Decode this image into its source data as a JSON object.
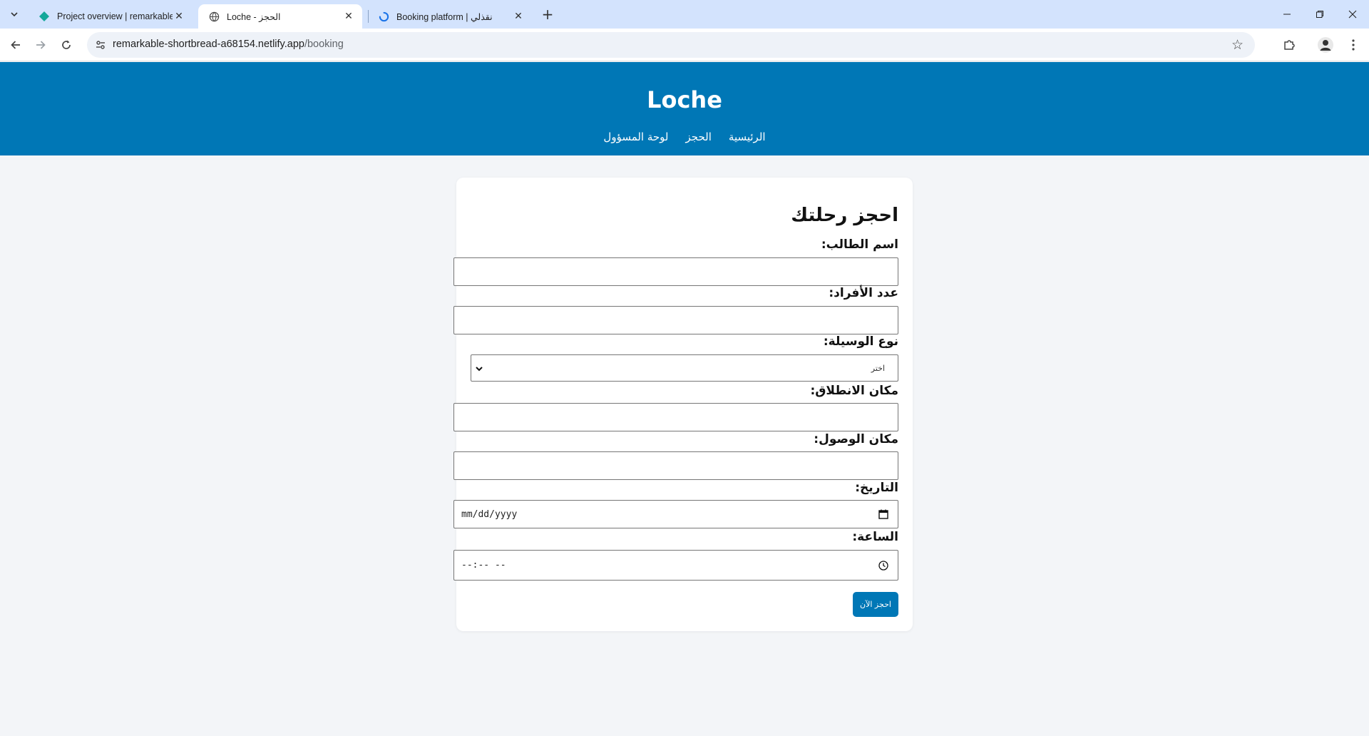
{
  "browser": {
    "tabs": [
      {
        "title": "Project overview | remarkable-s",
        "favicon": "netlify-diamond-icon",
        "active": false
      },
      {
        "title": "Loche - الحجز",
        "favicon": "globe-icon",
        "active": true
      },
      {
        "title": "Booking platform | نقذلي",
        "favicon": "loading-spinner-icon",
        "active": false
      }
    ],
    "url_host": "remarkable-shortbread-a68154.netlify.app",
    "url_path": "/booking",
    "colors": {
      "tabstrip": "#d3e3fd",
      "toolbar": "#ffffff",
      "omnibox": "#eef2f8"
    }
  },
  "site": {
    "title": "Loche",
    "nav": [
      "الرئيسية",
      "الحجز",
      "لوحة المسؤول"
    ],
    "colors": {
      "header": "#0077b6",
      "page_bg": "#f3f5f8",
      "button": "#0077b6"
    }
  },
  "form": {
    "heading": "احجز رحلتك",
    "student_name_label": "اسم الطالب:",
    "student_name_value": "",
    "count_label": "عدد الأفراد:",
    "count_value": "",
    "vehicle_label": "نوع الوسيلة:",
    "vehicle_selected": "اختر",
    "departure_label": "مكان الانطلاق:",
    "departure_value": "",
    "arrival_label": "مكان الوصول:",
    "arrival_value": "",
    "date_label": "التاريخ:",
    "date_placeholder": "mm/dd/yyyy",
    "time_label": "الساعة:",
    "time_placeholder": "--:-- --",
    "submit_label": "احجز الآن"
  }
}
